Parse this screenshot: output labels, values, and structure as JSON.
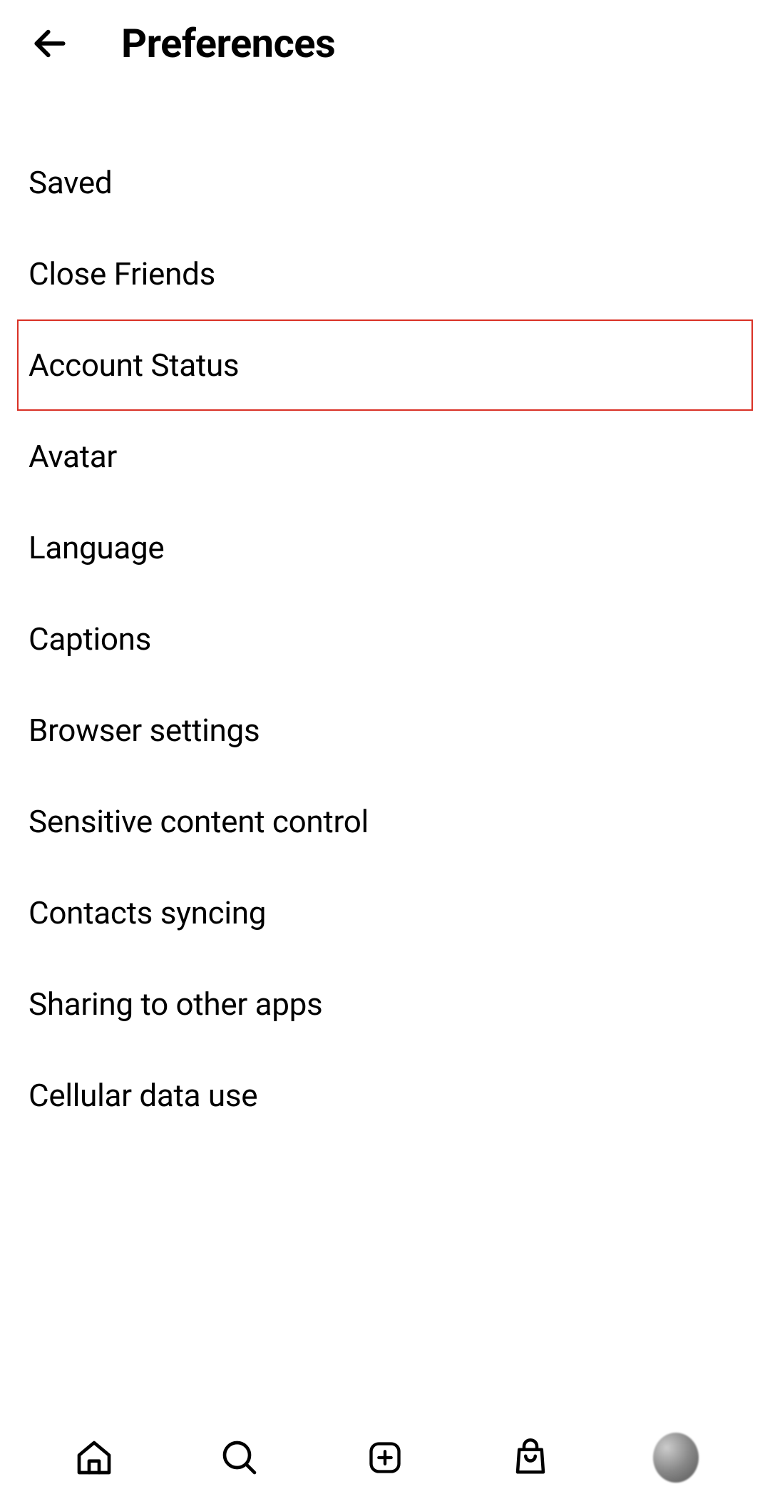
{
  "header": {
    "title": "Preferences"
  },
  "menu": {
    "items": [
      {
        "label": "Saved",
        "highlighted": false
      },
      {
        "label": "Close Friends",
        "highlighted": false
      },
      {
        "label": "Account Status",
        "highlighted": true
      },
      {
        "label": "Avatar",
        "highlighted": false
      },
      {
        "label": "Language",
        "highlighted": false
      },
      {
        "label": "Captions",
        "highlighted": false
      },
      {
        "label": "Browser settings",
        "highlighted": false
      },
      {
        "label": "Sensitive content control",
        "highlighted": false
      },
      {
        "label": "Contacts syncing",
        "highlighted": false
      },
      {
        "label": "Sharing to other apps",
        "highlighted": false
      },
      {
        "label": "Cellular data use",
        "highlighted": false
      }
    ]
  },
  "nav": {
    "home": "home",
    "search": "search",
    "create": "create",
    "shop": "shop",
    "profile": "profile"
  }
}
